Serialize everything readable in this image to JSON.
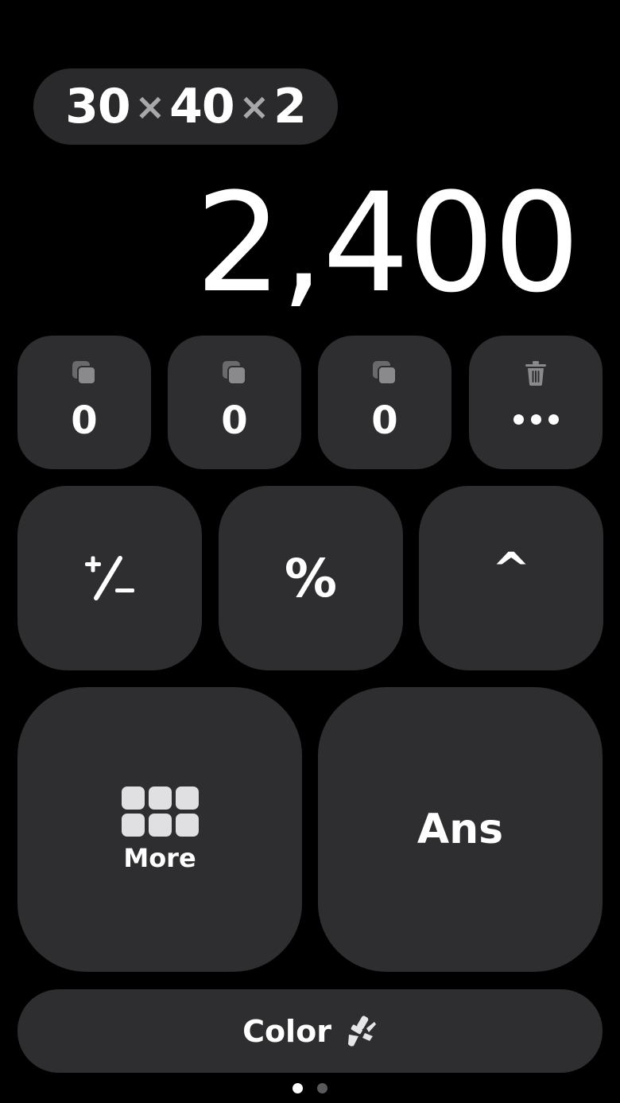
{
  "expression": {
    "parts": [
      "30",
      "×",
      "40",
      "×",
      "2"
    ]
  },
  "display": {
    "result": "2,400"
  },
  "memory": {
    "slots": [
      {
        "value": "0",
        "icon": "copy-icon"
      },
      {
        "value": "0",
        "icon": "copy-icon"
      },
      {
        "value": "0",
        "icon": "copy-icon"
      }
    ],
    "more": {
      "icon": "trash-icon",
      "label": "more-options-icon"
    }
  },
  "operators": {
    "plus_minus": "+/−",
    "percent": "%",
    "power": "^"
  },
  "big_keys": {
    "more_label": "More",
    "more_icon": "grid-icon",
    "ans_label": "Ans"
  },
  "color_bar": {
    "label": "Color",
    "icon": "paintbrush-icon"
  },
  "pagination": {
    "current_page": 1,
    "total_pages": 2
  },
  "colors": {
    "background": "#000000",
    "key": "#2e2e30",
    "pill": "#2a2a2c",
    "operator_symbol": "#a8a8aa",
    "active_dot": "#ffffff",
    "inactive_dot": "#5a5a5c"
  }
}
